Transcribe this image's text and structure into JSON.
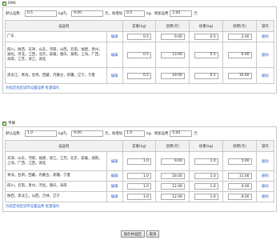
{
  "ems": {
    "label": "EMS",
    "defaults": {
      "prefix": "默认运费：",
      "first_weight": "0.5",
      "unit_kg": "kg内，",
      "first_fee": "9.00",
      "unit_yuan_per": "元，每增加",
      "add_weight": "0.5",
      "unit_kg2": "kg，增加运费",
      "add_fee": "2.00",
      "unit_yuan": "元"
    },
    "headers": [
      "运送到",
      "首重(kg)",
      "首费(元)",
      "续重(kg)",
      "续费(元)",
      "操作"
    ],
    "rows": [
      {
        "region": "广东",
        "edit": "编辑",
        "first_weight": "0.5",
        "first_fee": "9.00",
        "add_weight": "0.5",
        "add_fee": "2.00",
        "op": "删除"
      },
      {
        "region": "四川，陕西，天津，山东，河南，山西，云南，福建，贵州，湖北，河北，江西，北京，安徽，重庆，湖南，上海，广西，海南，江苏，浙江，湖北",
        "edit": "编辑",
        "first_weight": "0.5",
        "first_fee": "13.00",
        "add_weight": "0.5",
        "add_fee": "6.00",
        "op": "删除"
      },
      {
        "region": "黑龙江，青海，甘肃，西藏，内蒙古，新疆，辽宁，宁夏",
        "edit": "编辑",
        "first_weight": "0.5",
        "first_fee": "19.00",
        "add_weight": "0.5",
        "add_fee": "16.00",
        "op": "删除"
      }
    ],
    "batch_link": "为指定地区城市设置运费 批量操作"
  },
  "post": {
    "label": "平邮",
    "defaults": {
      "prefix": "默认运费：",
      "first_weight": "1.0",
      "unit_kg": "kg内，",
      "first_fee": "9.00",
      "unit_yuan_per": "元，每增加",
      "add_weight": "1.0",
      "unit_kg2": "kg，增加运费",
      "add_fee": "5.00",
      "unit_yuan": "元"
    },
    "headers": [
      "运送到",
      "首重(kg)",
      "首费(元)",
      "续重(kg)",
      "续费(元)",
      "操作"
    ],
    "rows": [
      {
        "region": "天津，山东，河南，福建，浙江，江苏，北京，安徽，湖南，上海，广西，江西，湖北",
        "edit": "编辑",
        "first_weight": "1.0",
        "first_fee": "9.00",
        "add_weight": "1.0",
        "add_fee": "5.00",
        "op": "删除"
      },
      {
        "region": "青海，甘肃，西藏，内蒙古，新疆，宁夏",
        "edit": "编辑",
        "first_weight": "1.0",
        "first_fee": "18.00",
        "add_weight": "1.0",
        "add_fee": "11.00",
        "op": "删除"
      },
      {
        "region": "四川，云南，贵州，河北，重庆，海南",
        "edit": "编辑",
        "first_weight": "1.0",
        "first_fee": "12.00",
        "add_weight": "1.0",
        "add_fee": "6.00",
        "op": "删除"
      },
      {
        "region": "陕西，黑龙江，山西，吉林，辽宁",
        "edit": "编辑",
        "first_weight": "1.0",
        "first_fee": "12.00",
        "add_weight": "1.0",
        "add_fee": "8.00",
        "op": "删除"
      }
    ],
    "batch_link": "为指定地区城市设置运费 批量操作"
  },
  "footer": {
    "save_label": "保存并返回",
    "cancel_label": "取消"
  }
}
